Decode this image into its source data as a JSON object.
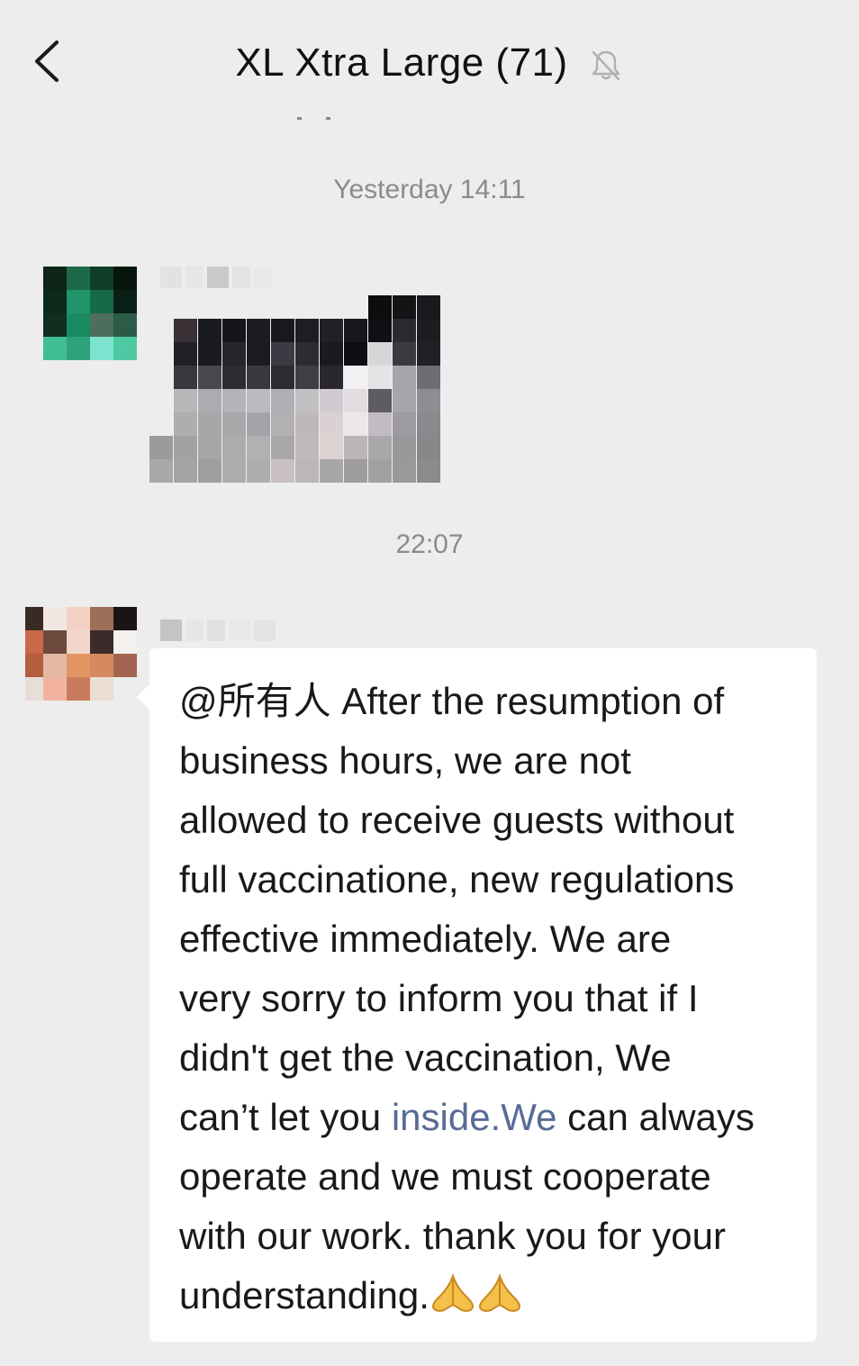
{
  "header": {
    "title": "XL Xtra Large (71)",
    "back_icon": "chevron-left-icon",
    "mute_icon": "bell-muted-icon"
  },
  "messages": [
    {
      "timestamp": "Yesterday 14:11",
      "type": "image"
    },
    {
      "timestamp": "22:07",
      "type": "text",
      "lines": [
        {
          "parts": [
            {
              "text": "@所有人  After the resumption of"
            }
          ]
        },
        {
          "parts": [
            {
              "text": "business hours, we are not"
            }
          ]
        },
        {
          "parts": [
            {
              "text": "allowed to receive guests without"
            }
          ]
        },
        {
          "parts": [
            {
              "text": "full vaccinatione, new regulations"
            }
          ]
        },
        {
          "parts": [
            {
              "text": "effective immediately. We are"
            }
          ]
        },
        {
          "parts": [
            {
              "text": "very sorry to inform you that if I"
            }
          ]
        },
        {
          "parts": [
            {
              "text": "didn't get the vaccination, We"
            }
          ]
        },
        {
          "parts": [
            {
              "text": "can’t let you "
            },
            {
              "text": "inside.We",
              "link": true
            },
            {
              "text": " can always"
            }
          ]
        },
        {
          "parts": [
            {
              "text": "operate and we must cooperate"
            }
          ]
        },
        {
          "parts": [
            {
              "text": "with our work. thank you for your"
            }
          ]
        },
        {
          "parts": [
            {
              "text": "understanding."
            }
          ]
        }
      ],
      "emoji": [
        "folded-hands-icon",
        "folded-hands-icon"
      ]
    }
  ],
  "colors": {
    "background": "#ededed",
    "bubble": "#ffffff",
    "link": "#576b95",
    "timestamp": "#8b8b8b"
  }
}
